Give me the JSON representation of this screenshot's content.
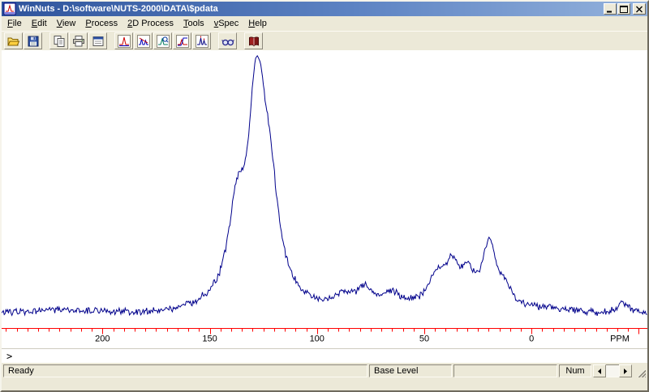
{
  "window": {
    "title": "WinNuts - D:\\software\\NUTS-2000\\DATA\\$pdata",
    "app_icon": "winnuts-app-icon",
    "controls": [
      {
        "name": "minimize-button",
        "icon": "minimize-icon"
      },
      {
        "name": "maximize-button",
        "icon": "maximize-icon"
      },
      {
        "name": "close-button",
        "icon": "close-icon"
      }
    ]
  },
  "menu": {
    "items": [
      "File",
      "Edit",
      "View",
      "Process",
      "2D Process",
      "Tools",
      "vSpec",
      "Help"
    ]
  },
  "toolbar": {
    "buttons": [
      {
        "name": "open-button",
        "icon": "open-folder-icon"
      },
      {
        "name": "save-button",
        "icon": "floppy-disk-icon"
      },
      {
        "name": "copy-button",
        "icon": "copy-icon"
      },
      {
        "name": "print-button",
        "icon": "printer-icon"
      },
      {
        "name": "page-setup-button",
        "icon": "window-form-icon"
      },
      {
        "name": "fourier-transform-button",
        "icon": "spectrum-ft-icon"
      },
      {
        "name": "phase-button",
        "icon": "spectrum-phase-icon"
      },
      {
        "name": "zoom-button",
        "icon": "spectrum-zoom-icon"
      },
      {
        "name": "integrate-button",
        "icon": "spectrum-integrate-icon"
      },
      {
        "name": "peak-pick-button",
        "icon": "spectrum-peaks-icon"
      },
      {
        "name": "view-button",
        "icon": "glasses-icon"
      },
      {
        "name": "notebook-button",
        "icon": "red-book-icon"
      }
    ]
  },
  "command_line": {
    "prompt": ">"
  },
  "status_bar": {
    "ready_text": "Ready",
    "mode_text": "Base Level",
    "extra_text": "",
    "num_lock_text": "Num"
  },
  "chart_data": {
    "type": "line",
    "title": "",
    "xlabel": "PPM",
    "ylabel": "",
    "x_axis_reversed": true,
    "xlim": [
      247,
      -54
    ],
    "x_ticks_labeled": [
      200,
      150,
      100,
      50,
      0
    ],
    "x_minor_tick_step_ppm": 5,
    "grid": false,
    "legend": false,
    "line_color": "#00008b",
    "axis_color": "#ff0000",
    "background": "#ffffff",
    "peaks": [
      {
        "center_ppm": 137.5,
        "height": 0.35,
        "hwhm_ppm": 4.5
      },
      {
        "center_ppm": 129.0,
        "height": 0.3,
        "hwhm_ppm": 3.0
      },
      {
        "center_ppm": 126.5,
        "height": 0.85,
        "hwhm_ppm": 6.5
      },
      {
        "center_ppm": 121.0,
        "height": 0.2,
        "hwhm_ppm": 4.0
      },
      {
        "center_ppm": 88.0,
        "height": 0.05,
        "hwhm_ppm": 4.0
      },
      {
        "center_ppm": 78.0,
        "height": 0.08,
        "hwhm_ppm": 5.0
      },
      {
        "center_ppm": 65.0,
        "height": 0.05,
        "hwhm_ppm": 5.0
      },
      {
        "center_ppm": 44.0,
        "height": 0.13,
        "hwhm_ppm": 5.0
      },
      {
        "center_ppm": 37.0,
        "height": 0.16,
        "hwhm_ppm": 4.0
      },
      {
        "center_ppm": 30.0,
        "height": 0.13,
        "hwhm_ppm": 4.0
      },
      {
        "center_ppm": 19.5,
        "height": 0.3,
        "hwhm_ppm": 4.0
      },
      {
        "center_ppm": 12.0,
        "height": 0.07,
        "hwhm_ppm": 3.0
      },
      {
        "center_ppm": -43.0,
        "height": 0.05,
        "hwhm_ppm": 4.0
      }
    ],
    "noise": {
      "seed": 20,
      "amplitude_frac": 0.016,
      "baseline_frac": 0.88
    },
    "sample_step_ppm": 0.4
  }
}
